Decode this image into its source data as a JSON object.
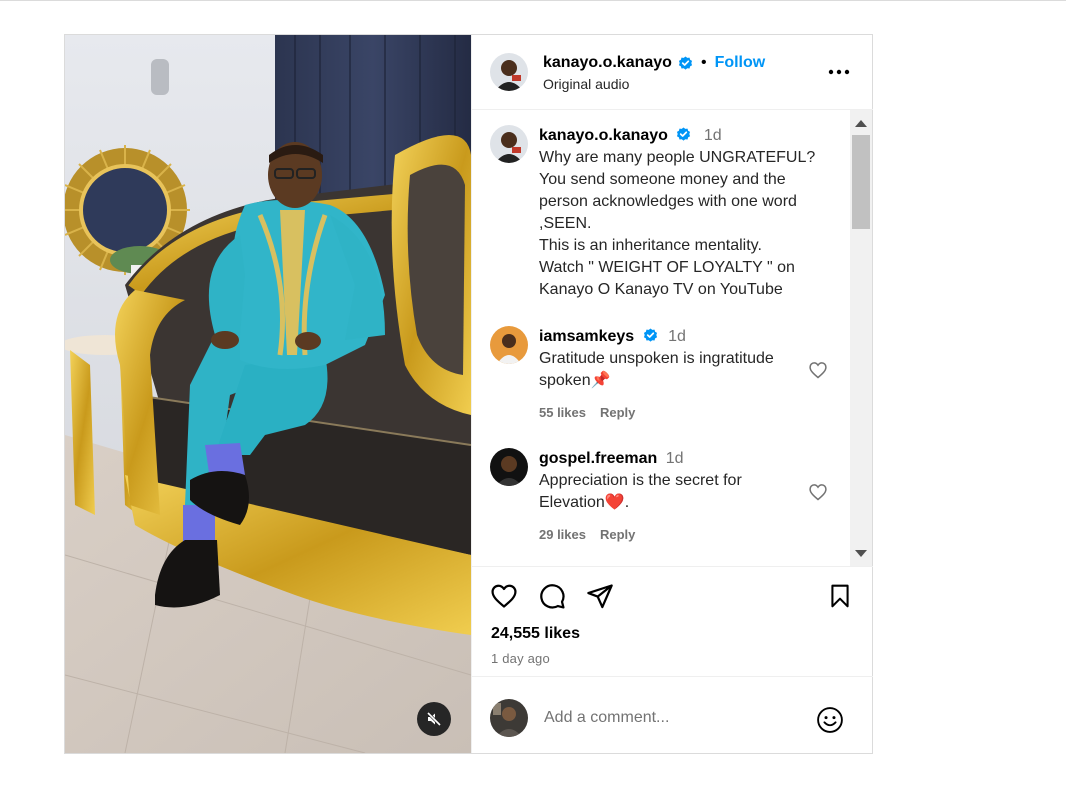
{
  "colors": {
    "accent": "#0095f6",
    "border": "#dbdbdb",
    "muted": "#737373",
    "like_red": "#ed4956"
  },
  "header": {
    "username": "kanayo.o.kanayo",
    "verified_icon": "verified-badge-icon",
    "separator": "•",
    "follow_label": "Follow",
    "subtitle": "Original audio",
    "more_icon": "more-options-icon"
  },
  "media": {
    "mute_icon": "speaker-muted-icon"
  },
  "caption": {
    "username": "kanayo.o.kanayo",
    "time": "1d",
    "text": "Why are many people UNGRATEFUL?\nYou send someone money and the person acknowledges with one word ,SEEN.\nThis is an inheritance mentality.\nWatch \" WEIGHT OF LOYALTY \" on Kanayo O Kanayo TV on YouTube"
  },
  "comments": [
    {
      "username": "iamsamkeys",
      "verified": true,
      "time": "1d",
      "text": "Gratitude unspoken is ingratitude spoken📌",
      "likes": "55 likes",
      "reply": "Reply"
    },
    {
      "username": "gospel.freeman",
      "verified": false,
      "time": "1d",
      "text": "Appreciation is the secret for Elevation❤️.",
      "likes": "29 likes",
      "reply": "Reply"
    }
  ],
  "actions": {
    "like_icon": "heart-icon",
    "comment_icon": "comment-icon",
    "share_icon": "send-icon",
    "save_icon": "bookmark-icon",
    "likes": "24,555 likes",
    "posted": "1 day ago"
  },
  "add_comment": {
    "placeholder": "Add a comment...",
    "emoji_icon": "emoji-icon"
  }
}
